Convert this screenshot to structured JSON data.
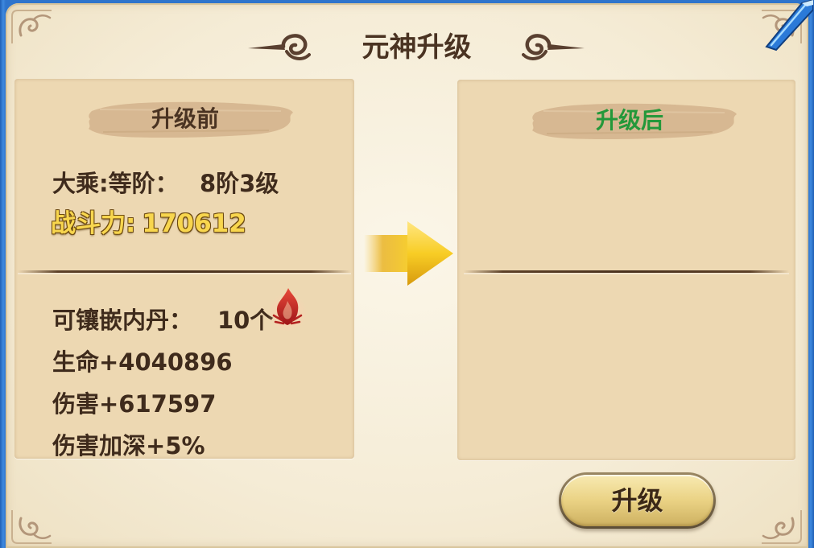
{
  "dialog": {
    "title": "元神升级"
  },
  "before": {
    "header": "升级前",
    "realm": {
      "label": "大乘:等阶：",
      "value": "8阶3级"
    },
    "power": {
      "label": "战斗力:",
      "value": "170612"
    },
    "inlay": {
      "label": "可镶嵌内丹：",
      "value": "10个"
    },
    "stats": [
      "生命+4040896",
      "伤害+617597",
      "伤害加深+5%"
    ]
  },
  "after": {
    "header": "升级后"
  },
  "actions": {
    "upgrade_label": "升级"
  },
  "icons": {
    "close": "close-blade-icon",
    "transition": "arrow-right-icon",
    "inner_core": "flame-icon",
    "title_ornament": "cloud-swirl-icon",
    "corner_ornament": "corner-swirl-icon"
  },
  "colors": {
    "frame_blue": "#3479cf",
    "parchment": "#f5ecd6",
    "panel": "#edd8b2",
    "text_brown": "#3f2b1c",
    "power_gold": "#f8d64e",
    "after_green": "#24983a",
    "flame_red": "#c8262a"
  }
}
